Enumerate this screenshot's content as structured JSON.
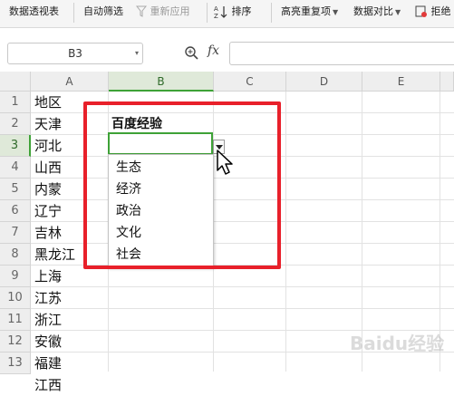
{
  "toolbar": {
    "pivot": "数据透视表",
    "autofilter": "自动筛选",
    "reapply": "重新应用",
    "sort": "排序",
    "highlight_dup": "高亮重复项",
    "compare": "数据对比",
    "reject": "拒绝"
  },
  "formula_bar": {
    "name_box": "B3",
    "fx": "fx",
    "value": ""
  },
  "columns": [
    "A",
    "B",
    "C",
    "D",
    "E"
  ],
  "selected_column": "B",
  "rows": [
    "1",
    "2",
    "3",
    "4",
    "5",
    "6",
    "7",
    "8",
    "9",
    "10",
    "11",
    "12",
    "13"
  ],
  "selected_row": "3",
  "column_a": [
    "地区",
    "天津",
    "河北",
    "山西",
    "内蒙",
    "辽宁",
    "吉林",
    "黑龙江",
    "上海",
    "江苏",
    "浙江",
    "安徽",
    "福建",
    "江西"
  ],
  "cell_b2": "百度经验",
  "dropdown": {
    "options": [
      "生态",
      "经济",
      "政治",
      "文化",
      "社会"
    ]
  },
  "colors": {
    "selection_green": "#3ea237",
    "annotation_red": "#e8202a"
  },
  "watermark": "Baidu经验"
}
